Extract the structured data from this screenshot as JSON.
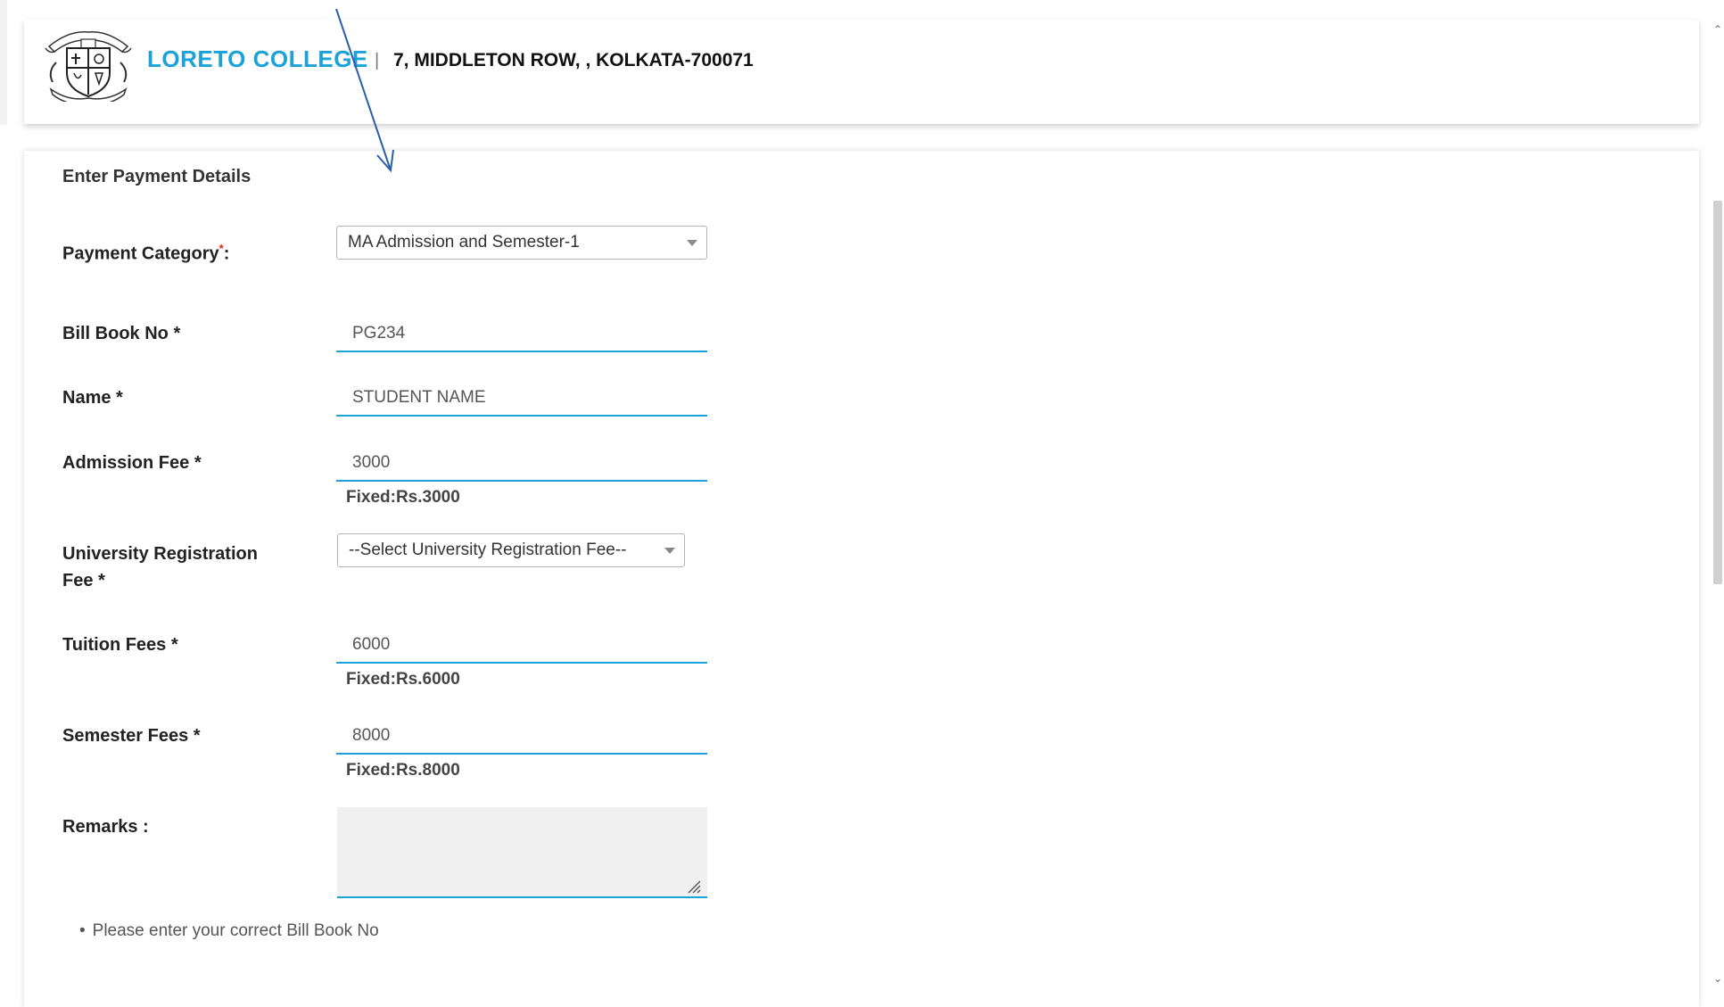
{
  "header": {
    "college_name": "LORETO COLLEGE",
    "separator": "|",
    "address": "7, MIDDLETON ROW, , KOLKATA-700071"
  },
  "form": {
    "title": "Enter Payment Details",
    "payment_category": {
      "label": "Payment Category",
      "required_mark": "*",
      "label_suffix": ":",
      "selected": "MA Admission and Semester-1"
    },
    "bill_book_no": {
      "label": "Bill Book No *",
      "value": "PG234"
    },
    "name": {
      "label": "Name *",
      "value": "STUDENT NAME"
    },
    "admission_fee": {
      "label": "Admission Fee *",
      "value": "3000",
      "hint": "Fixed:Rs.3000"
    },
    "university_registration_fee": {
      "label_line1": "University Registration",
      "label_line2": "Fee *",
      "selected": "--Select University Registration Fee--"
    },
    "tuition_fees": {
      "label": "Tuition Fees *",
      "value": "6000",
      "hint": "Fixed:Rs.6000"
    },
    "semester_fees": {
      "label": "Semester Fees *",
      "value": "8000",
      "hint": "Fixed:Rs.8000"
    },
    "remarks": {
      "label": "Remarks :",
      "value": ""
    },
    "note": "Please enter your correct Bill Book No"
  },
  "colors": {
    "brand": "#1ba2d8",
    "input_underline": "#1ba2d8",
    "required_star": "#e02020",
    "annotation_arrow": "#2a5ea8"
  },
  "icons": {
    "logo": "college-crest-logo",
    "dropdown": "caret-down-icon",
    "resize": "resize-handle-icon",
    "annotation": "arrow-annotation-icon"
  }
}
